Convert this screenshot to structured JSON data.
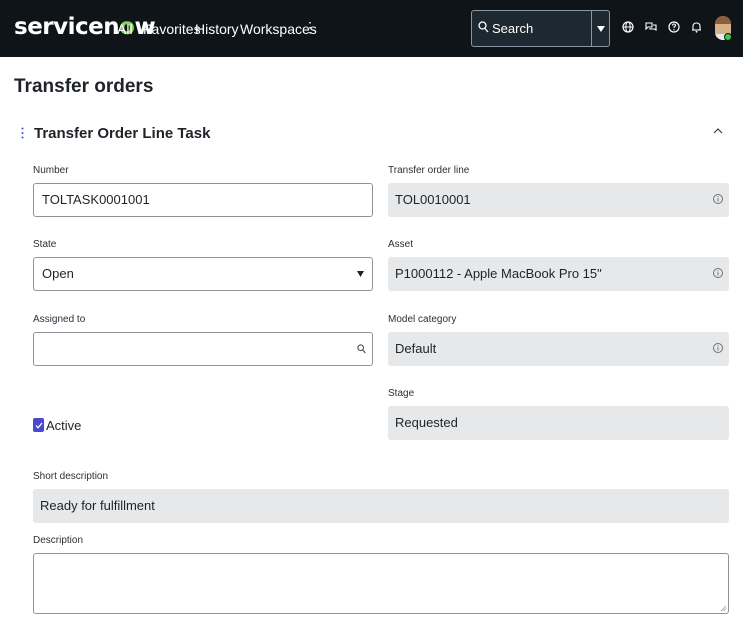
{
  "nav": {
    "brand_prefix": "servicen",
    "brand_o": "o",
    "brand_suffix": "w",
    "links": [
      "All",
      "Favorites",
      "History",
      "Workspaces"
    ],
    "more": "⋮",
    "search_label": "Search"
  },
  "page": {
    "title": "Transfer orders"
  },
  "section": {
    "title": "Transfer Order Line Task"
  },
  "fields": {
    "number": {
      "label": "Number",
      "value": "TOLTASK0001001"
    },
    "transfer_order_line": {
      "label": "Transfer order line",
      "value": "TOL0010001"
    },
    "state": {
      "label": "State",
      "value": "Open"
    },
    "asset": {
      "label": "Asset",
      "value": "P1000112 - Apple MacBook Pro 15\""
    },
    "assigned_to": {
      "label": "Assigned to",
      "value": ""
    },
    "model_category": {
      "label": "Model category",
      "value": "Default"
    },
    "stage": {
      "label": "Stage",
      "value": "Requested"
    },
    "active": {
      "label": "Active",
      "checked": true
    },
    "short_description": {
      "label": "Short description",
      "value": "Ready for fulfillment"
    },
    "description": {
      "label": "Description",
      "value": ""
    }
  },
  "colors": {
    "nav_bg": "#0f1419",
    "brand_accent": "#81d35a",
    "readonly_bg": "#e6e8ea",
    "checkbox": "#4a4ad1"
  },
  "icons": [
    "search-icon",
    "dropdown-caret-icon",
    "globe-icon",
    "chat-icon",
    "help-icon",
    "bell-icon",
    "avatar",
    "kebab-icon",
    "chevron-up-icon",
    "info-icon",
    "magnifier-icon",
    "checkmark-icon",
    "resize-grip-icon"
  ]
}
